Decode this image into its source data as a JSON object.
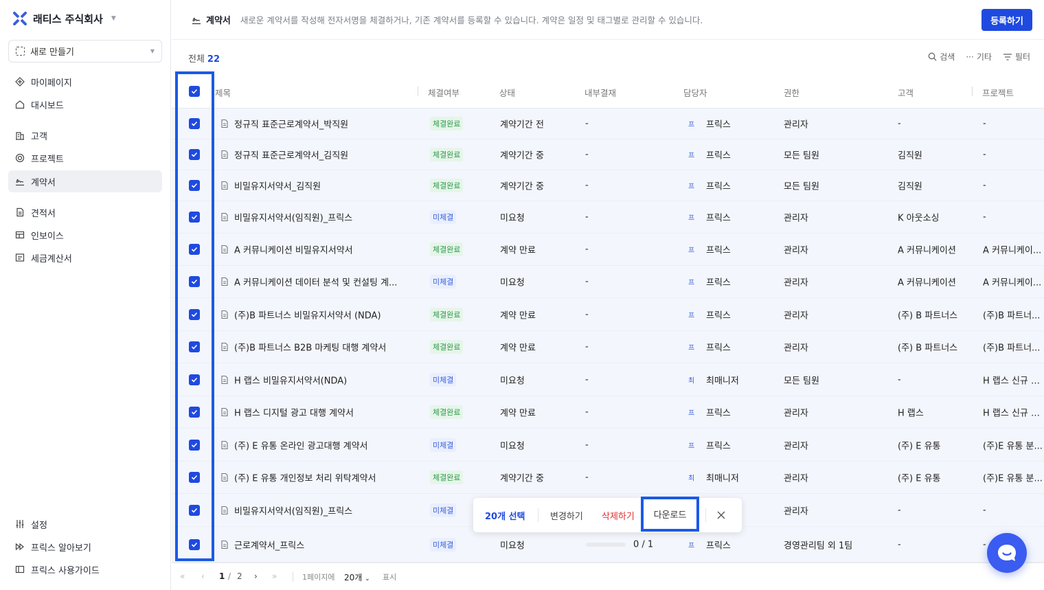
{
  "sidebar": {
    "brand": "래티스 주식회사",
    "new_button": "새로 만들기",
    "items": [
      {
        "label": "마이페이지",
        "icon": "diamond-icon"
      },
      {
        "label": "대시보드",
        "icon": "home-icon"
      },
      {
        "label": "고객",
        "icon": "building-icon"
      },
      {
        "label": "프로젝트",
        "icon": "target-icon"
      },
      {
        "label": "계약서",
        "icon": "signature-icon",
        "active": true
      },
      {
        "label": "견적서",
        "icon": "document-icon"
      },
      {
        "label": "인보이스",
        "icon": "invoice-icon"
      },
      {
        "label": "세금계산서",
        "icon": "receipt-icon"
      }
    ],
    "footer_items": [
      {
        "label": "설정",
        "icon": "sliders-icon"
      },
      {
        "label": "프릭스 알아보기",
        "icon": "play-icon"
      },
      {
        "label": "프릭스 사용가이드",
        "icon": "book-icon"
      }
    ]
  },
  "header": {
    "title": "계약서",
    "description": "새로운 계약서를 작성해 전자서명을 체결하거나, 기존 계약서를 등록할 수 있습니다. 계약은 일정 및 태그별로 관리할 수 있습니다.",
    "register_button": "등록하기"
  },
  "toolbar": {
    "total_label": "전체",
    "total_count": "22",
    "search": "검색",
    "more": "기타",
    "filter": "필터"
  },
  "table": {
    "columns": [
      "제목",
      "체결여부",
      "상태",
      "내부결재",
      "담당자",
      "권한",
      "고객",
      "프로젝트"
    ],
    "rows": [
      {
        "title": "정규직 표준근로계약서_박직원",
        "signed": "체결완료",
        "signed_type": "done",
        "status": "계약기간 전",
        "approval": "-",
        "avatar": "프",
        "owner": "프릭스",
        "perm": "관리자",
        "client": "-",
        "project": "-"
      },
      {
        "title": "정규직 표준근로계약서_김직원",
        "signed": "체결완료",
        "signed_type": "done",
        "status": "계약기간 중",
        "approval": "-",
        "avatar": "프",
        "owner": "프릭스",
        "perm": "모든 팀원",
        "client": "김직원",
        "project": "-"
      },
      {
        "title": "비밀유지서약서_김직원",
        "signed": "체결완료",
        "signed_type": "done",
        "status": "계약기간 중",
        "approval": "-",
        "avatar": "프",
        "owner": "프릭스",
        "perm": "모든 팀원",
        "client": "김직원",
        "project": "-"
      },
      {
        "title": "비밀유지서약서(임직원)_프릭스",
        "signed": "미체결",
        "signed_type": "not",
        "status": "미요청",
        "approval": "-",
        "avatar": "프",
        "owner": "프릭스",
        "perm": "관리자",
        "client": "K 아웃소싱",
        "project": "-"
      },
      {
        "title": "A 커뮤니케이션 비밀유지서약서",
        "signed": "체결완료",
        "signed_type": "done",
        "status": "계약 만료",
        "approval": "-",
        "avatar": "프",
        "owner": "프릭스",
        "perm": "관리자",
        "client": "A 커뮤니케이션",
        "project": "A 커뮤니케이..."
      },
      {
        "title": "A 커뮤니케이션 데이터 분석 및 컨설팅 계...",
        "signed": "미체결",
        "signed_type": "not",
        "status": "미요청",
        "approval": "-",
        "avatar": "프",
        "owner": "프릭스",
        "perm": "관리자",
        "client": "A 커뮤니케이션",
        "project": "A 커뮤니케이..."
      },
      {
        "title": "(주)B 파트너스 비밀유지서약서 (NDA)",
        "signed": "체결완료",
        "signed_type": "done",
        "status": "계약 만료",
        "approval": "-",
        "avatar": "프",
        "owner": "프릭스",
        "perm": "관리자",
        "client": "(주) B 파트너스",
        "project": "(주)B 파트너..."
      },
      {
        "title": "(주)B 파트너스 B2B 마케팅 대행 계약서",
        "signed": "체결완료",
        "signed_type": "done",
        "status": "계약 만료",
        "approval": "-",
        "avatar": "프",
        "owner": "프릭스",
        "perm": "관리자",
        "client": "(주) B 파트너스",
        "project": "(주)B 파트너..."
      },
      {
        "title": "H 랩스 비밀유지서약서(NDA)",
        "signed": "미체결",
        "signed_type": "not",
        "status": "미요청",
        "approval": "-",
        "avatar": "최",
        "owner": "최매니저",
        "perm": "모든 팀원",
        "client": "-",
        "project": "H 랩스 신규 서..."
      },
      {
        "title": "H 랩스 디지털 광고 대행 계약서",
        "signed": "체결완료",
        "signed_type": "done",
        "status": "계약 만료",
        "approval": "-",
        "avatar": "프",
        "owner": "프릭스",
        "perm": "관리자",
        "client": "H 랩스",
        "project": "H 랩스 신규 서..."
      },
      {
        "title": "(주) E 유통 온라인 광고대행 계약서",
        "signed": "미체결",
        "signed_type": "not",
        "status": "미요청",
        "approval": "-",
        "avatar": "프",
        "owner": "프릭스",
        "perm": "관리자",
        "client": "(주) E 유통",
        "project": "(주)E 유통 분..."
      },
      {
        "title": "(주) E 유통 개인정보 처리 위탁계약서",
        "signed": "체결완료",
        "signed_type": "done",
        "status": "계약기간 중",
        "approval": "-",
        "avatar": "최",
        "owner": "최매니저",
        "perm": "관리자",
        "client": "(주) E 유통",
        "project": "(주)E 유통 분..."
      },
      {
        "title": "비밀유지서약서(임직원)_프릭스",
        "signed": "미체결",
        "signed_type": "not",
        "status": "",
        "approval": "",
        "avatar": "",
        "owner": "",
        "perm": "관리자",
        "client": "-",
        "project": "-"
      },
      {
        "title": "근로계약서_프릭스",
        "signed": "미체결",
        "signed_type": "not",
        "status": "미요청",
        "approval": "0 / 1",
        "approval_progress": 0,
        "avatar": "프",
        "owner": "프릭스",
        "perm": "경영관리팀 외 1팀",
        "client": "-",
        "project": "-"
      }
    ]
  },
  "actionbar": {
    "selected": "20개 선택",
    "change": "변경하기",
    "delete": "삭제하기",
    "download": "다운로드"
  },
  "pager": {
    "current": "1",
    "slash": "/",
    "total": "2",
    "per_page_label": "1페이지에",
    "per_page": "20개",
    "display": "표시"
  },
  "colors": {
    "accent": "#1f4ae0",
    "highlight": "#1a5ae6",
    "done": "#2f9a4a",
    "delete": "#e03030"
  }
}
